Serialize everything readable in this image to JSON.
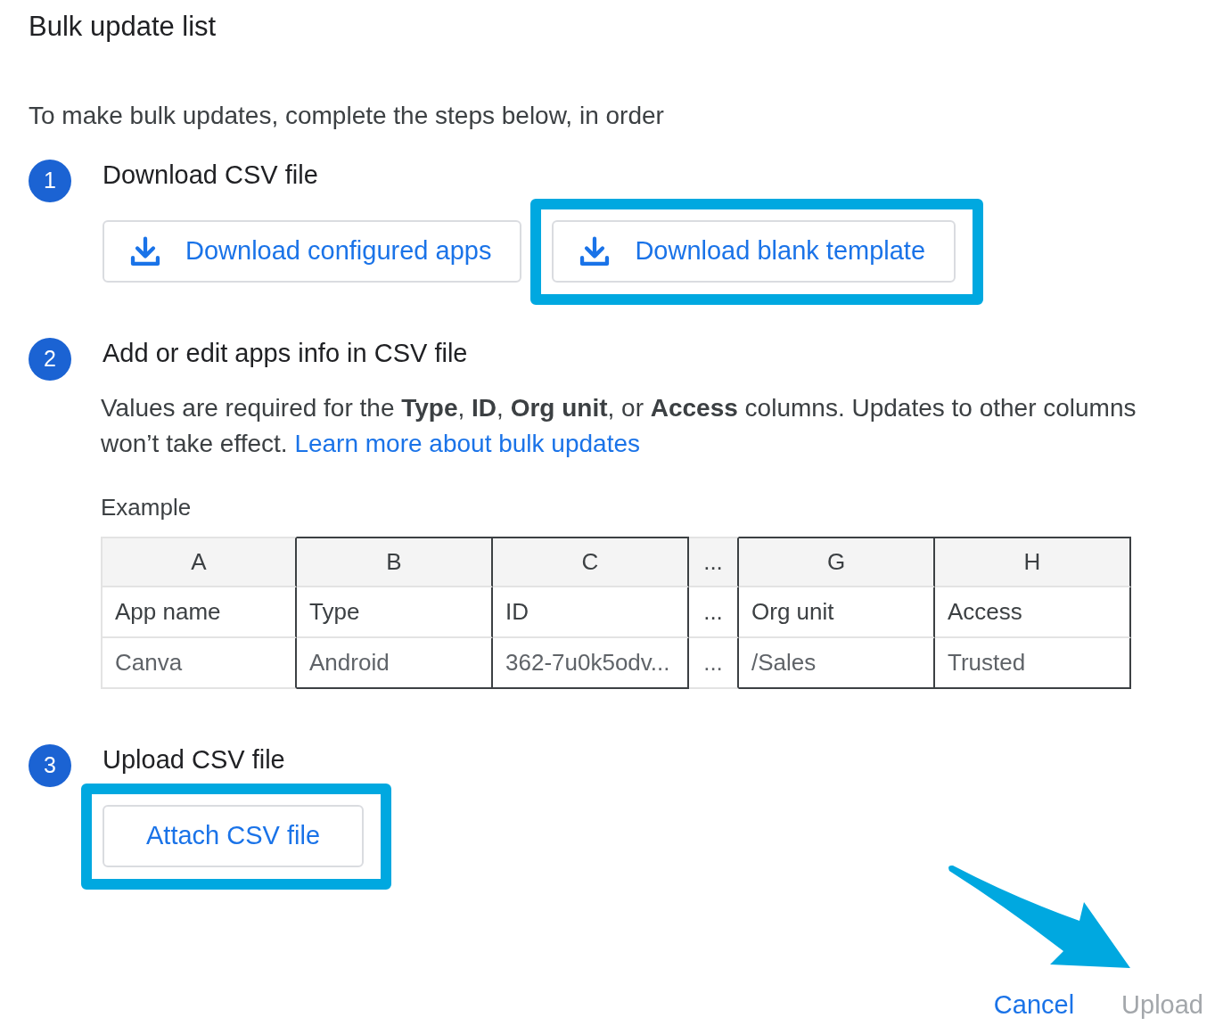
{
  "dialog": {
    "title": "Bulk update list",
    "intro": "To make bulk updates, complete the steps below, in order"
  },
  "steps": [
    {
      "number": "1",
      "title": "Download CSV file",
      "kind": "buttons",
      "buttons": [
        {
          "label": "Download configured apps",
          "kind": "download",
          "highlighted": false
        },
        {
          "label": "Download blank template",
          "kind": "download",
          "highlighted": true
        }
      ]
    },
    {
      "number": "2",
      "title": "Add or edit apps info in CSV file",
      "kind": "instructions",
      "description": "Values are required for the **Type**, **ID**, **Org unit**, or **Access** columns. Updates to other columns won’t take effect.",
      "link": "Learn more about bulk updates",
      "example": {
        "label": "Example",
        "columns": [
          {
            "header": "A",
            "kind": "data",
            "outlined": false
          },
          {
            "header": "B",
            "kind": "data",
            "outlined": true
          },
          {
            "header": "C",
            "kind": "data",
            "outlined": true
          },
          {
            "header": "...",
            "kind": "gap",
            "outlined": false
          },
          {
            "header": "G",
            "kind": "data",
            "outlined": true
          },
          {
            "header": "H",
            "kind": "data",
            "outlined": true
          }
        ],
        "rows": [
          {
            "kind": "names",
            "cells": [
              "App name",
              "Type",
              "ID",
              "...",
              "Org unit",
              "Access"
            ]
          },
          {
            "kind": "sample",
            "cells": [
              "Canva",
              "Android",
              "362-7u0k5odv...",
              "...",
              "/Sales",
              "Trusted"
            ]
          }
        ]
      }
    },
    {
      "number": "3",
      "title": "Upload CSV file",
      "kind": "buttons",
      "buttons": [
        {
          "label": "Attach CSV file",
          "kind": "attach",
          "highlighted": true
        }
      ]
    }
  ],
  "footer": {
    "buttons": [
      {
        "label": "Cancel",
        "disabled": false,
        "arrow": false
      },
      {
        "label": "Upload",
        "disabled": true,
        "arrow": true
      }
    ]
  }
}
